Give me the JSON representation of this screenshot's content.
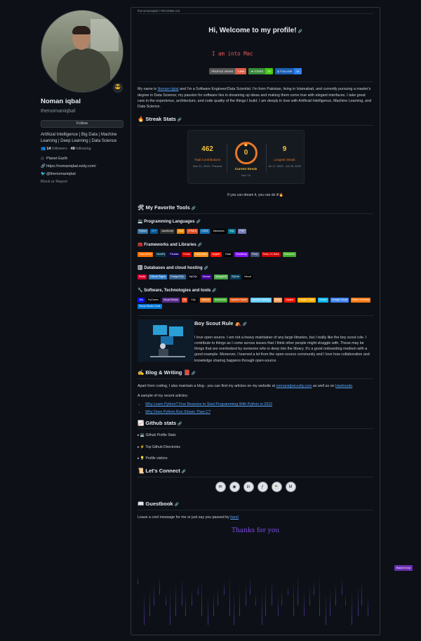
{
  "profile": {
    "name": "Noman iqbal",
    "login": "thenomaniqbal",
    "follow_label": "Follow",
    "bio": "Artificial Intelligence | Big Data | Machine Learning | Deep Learning | Data Science",
    "followers_count": "14",
    "followers_label": "followers",
    "following_count": "48",
    "following_label": "following",
    "location": "Planet Earth",
    "website": "https://nomaniqbal.ezity.com/",
    "twitter": "@thenomaniqbal",
    "report": "Block or Report",
    "emoji": "😎"
  },
  "readme": {
    "file_header": "thenomaniqbal / README.md",
    "title": "Hi, Welcome to my profile!",
    "typing_text": "I am into Mac",
    "badges": [
      {
        "left": "PROFILE VIEWS",
        "right": "3,858",
        "lc": "#555555",
        "rc": "#e05d44"
      },
      {
        "left": "★ STARS",
        "right": "39",
        "lc": "#3a8a3a",
        "rc": "#4c1"
      },
      {
        "left": "◎ FOLLOW",
        "right": "14",
        "lc": "#1a5fb4",
        "rc": "#2f80ed"
      }
    ],
    "intro_pre": "My name is ",
    "intro_link": "Noman Iqbal",
    "intro_post": " and I'm a Software Engineer/Data Scientist. I'm from Pakistan, living in Islamabad, and currently pursuing a master's degree in Data Science; my passion for software lies in dreaming up ideas and making them come true with elegant interfaces. I take great care in the experience, architecture, and code quality of the things I build. I am deeply in love with Artificial Intelligence, Machine Learning, and Data Science.",
    "streak_heading": "🔥 Streak Stats",
    "streak": {
      "total": "462",
      "total_label": "Total Contributions",
      "total_range": "Nov 21, 2018 - Present",
      "current": "0",
      "current_label": "Current Streak",
      "current_date": "Nov 14",
      "longest": "9",
      "longest_label": "Longest Streak",
      "longest_range": "Jul 17, 2022 - Jul 25, 2022"
    },
    "streak_note": "If you can dream it, you can do it!🔥",
    "tools_heading": "🛠 My Favorite Tools",
    "lang_heading": "💻 Programming Languages",
    "languages": [
      {
        "t": "Python",
        "c": "#3670a0"
      },
      {
        "t": "C++",
        "c": "#00599c"
      },
      {
        "t": "JavaScript",
        "c": "#323330"
      },
      {
        "t": "Java",
        "c": "#ed8b00"
      },
      {
        "t": "HTML5",
        "c": "#e34f26"
      },
      {
        "t": "CSS3",
        "c": "#1572b6"
      },
      {
        "t": "Markdown",
        "c": "#000000"
      },
      {
        "t": "SQL",
        "c": "#00758f"
      },
      {
        "t": "PHP",
        "c": "#777bb4"
      }
    ],
    "fw_heading": "🧰 Frameworks and Libraries",
    "frameworks": [
      {
        "t": "TensorFlow",
        "c": "#ff6f00"
      },
      {
        "t": "NumPy",
        "c": "#013243"
      },
      {
        "t": "Pandas",
        "c": "#150458"
      },
      {
        "t": "Keras",
        "c": "#d00000"
      },
      {
        "t": "scikit-learn",
        "c": "#f7931e"
      },
      {
        "t": "Jupyter",
        "c": "#fa0f00"
      },
      {
        "t": "Flask",
        "c": "#000000"
      },
      {
        "t": "Bootstrap",
        "c": "#8511fa"
      },
      {
        "t": "Plotly",
        "c": "#3f4f75"
      },
      {
        "t": "Ruby On Rails",
        "c": "#cc0000"
      },
      {
        "t": "Selenium",
        "c": "#43b02a"
      }
    ],
    "db_heading": "🗄 Databases and cloud hosting",
    "databases": [
      {
        "t": "Redis",
        "c": "#dd0031"
      },
      {
        "t": "Github Pages",
        "c": "#327fc7"
      },
      {
        "t": "PostgreSQL",
        "c": "#316192"
      },
      {
        "t": "MySQL",
        "c": "#00000f"
      },
      {
        "t": "Heroku",
        "c": "#430098"
      },
      {
        "t": "MongoDB",
        "c": "#4ea94b"
      },
      {
        "t": "SQLite",
        "c": "#07405e"
      },
      {
        "t": "Vercel",
        "c": "#000000"
      }
    ],
    "sw_heading": "🔧 Software, Technologies and tools",
    "software": [
      {
        "t": "Jira",
        "c": "#0a0fff"
      },
      {
        "t": "PyCharm",
        "c": "#000000"
      },
      {
        "t": "Visual Studio",
        "c": "#5c2d91"
      },
      {
        "t": "Git",
        "c": "#f05033"
      },
      {
        "t": "SQL",
        "c": "#000000"
      },
      {
        "t": "Tableau",
        "c": "#e97627"
      },
      {
        "t": "Anaconda",
        "c": "#44a833"
      },
      {
        "t": "Apache Spark",
        "c": "#e25a1c"
      },
      {
        "t": "Apache Hadoop",
        "c": "#66ccff"
      },
      {
        "t": "Dask",
        "c": "#fda061"
      },
      {
        "t": "Jupyter",
        "c": "#fa0f00"
      },
      {
        "t": "Google Colab",
        "c": "#f9ab00"
      },
      {
        "t": "Docker",
        "c": "#0db7ed"
      },
      {
        "t": "Google Cloud",
        "c": "#4285f4"
      },
      {
        "t": "Stack Overflow",
        "c": "#fe7a16"
      },
      {
        "t": "Visual Studio Code",
        "c": "#0078d7"
      }
    ],
    "scout_heading": "Boy Scout Rule",
    "scout_text": "I love open source. I am not a heavy maintainer of any large libraries, but I really like the boy scout rule. I contribute to things as I come across issues that I think other people might struggle with. These may be things that are overlooked by someone who is deep into the library. It's a good onboarding medium with a good example. Moreover, I learned a lot from the open-source community and I love how collaboration and knowledge sharing happens through open-source.",
    "blog_heading": "✍ Blog & Writing 📕",
    "blog_pre": "Apart from coding, I also maintain a blog - you can find my articles on my website at ",
    "blog_link1": "nomaniqbal.ezity.com",
    "blog_mid": " as well as on ",
    "blog_link2": "Hashnode",
    "blog_post": ".",
    "articles_intro": "A sample of my recent articles:",
    "articles": [
      "Why Learn Python? Five Reasons to Start Programming With Python in 2022",
      "Why Does Python Run Slower Than C?"
    ],
    "stats_heading": "📈 Github stats",
    "details": [
      "▸ 💻 Github Profile Stats",
      "▸ ⚡ Top Github Directories",
      "▸ 💡 Profile visitors"
    ],
    "connect_heading": "📜 Let's Connect",
    "socials": [
      "✉",
      "◉",
      "in",
      "ƒ",
      "☕",
      "M"
    ],
    "guestbook_heading": "📖 Guestbook",
    "guest_pre": "Leave a cool message for me or just say you passed by ",
    "guest_link": "here!",
    "thanks": "Thanks for you",
    "back_to_top": "Back to top"
  }
}
